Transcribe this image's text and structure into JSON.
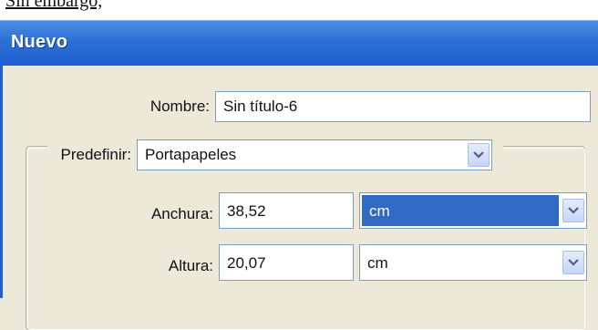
{
  "top_strip": {
    "text": "Sin embargo,"
  },
  "window": {
    "title": "Nuevo"
  },
  "form": {
    "nombre_label": "Nombre:",
    "nombre_value": "Sin título-6",
    "predefinir_label": "Predefinir:",
    "predefinir_value": "Portapapeles",
    "anchura_label": "Anchura:",
    "anchura_value": "38,52",
    "anchura_unit": "cm",
    "altura_label": "Altura:",
    "altura_value": "20,07",
    "altura_unit": "cm"
  },
  "icons": {
    "dropdown": "chevron-down-icon"
  },
  "colors": {
    "titlebar": "#2d6fd6",
    "selection": "#316ac5",
    "dialog_bg": "#ece9d8"
  }
}
